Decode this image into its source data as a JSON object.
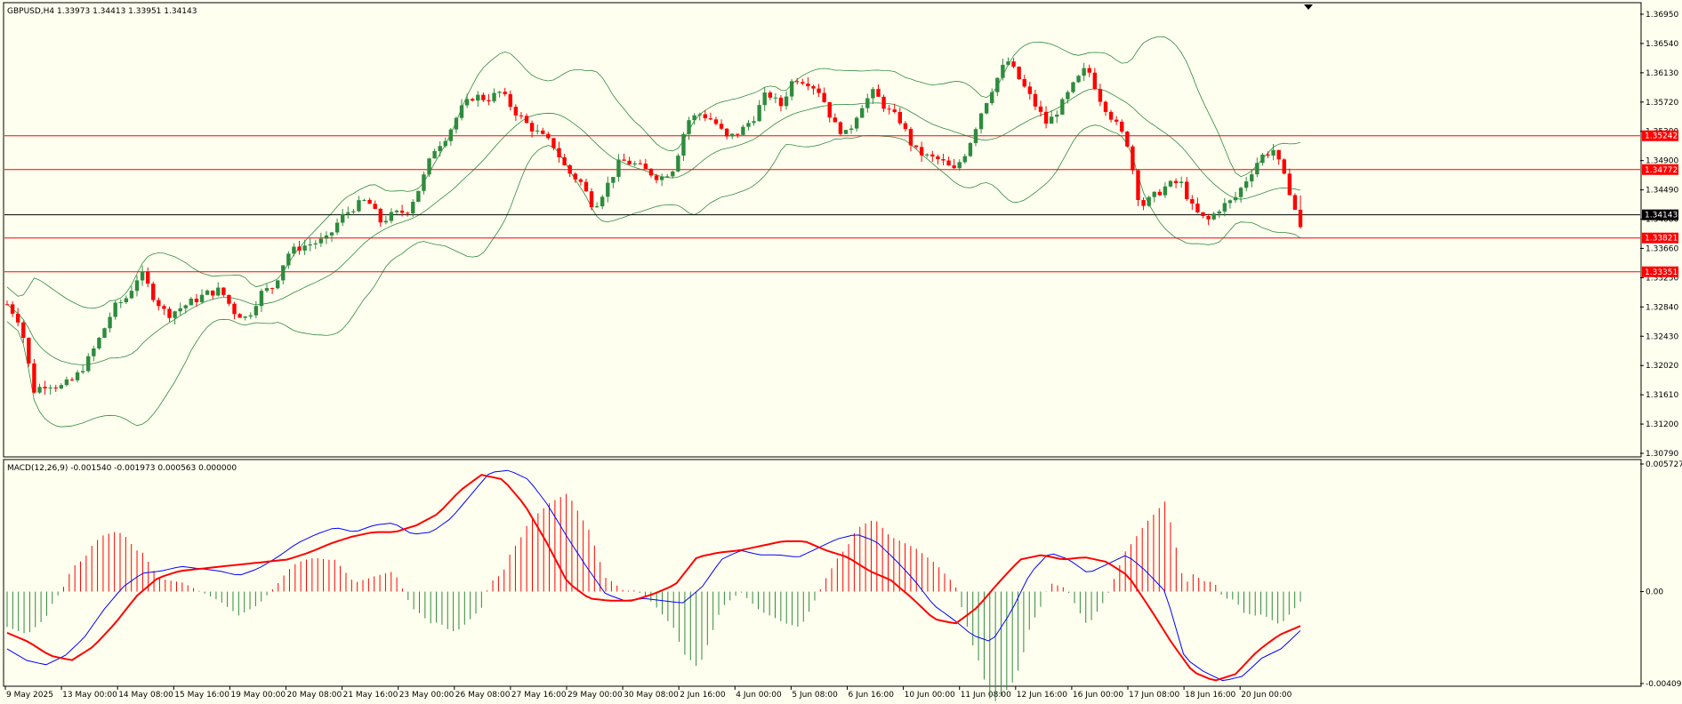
{
  "symbol_header": {
    "text": "GBPUSD,H4  1.33973 1.34413 1.33951 1.34143"
  },
  "indicator_header": {
    "text": "MACD(12,26,9) -0.001540 -0.001973 0.000563 0.000000"
  },
  "colors": {
    "background": "#fffff0",
    "bull_candle": "#2e8b3e",
    "bear_candle": "#ff0000",
    "bollinger": "#2e8b3e",
    "hline": "#ff0000",
    "price_line": "#000000",
    "macd_main": "#0000ff",
    "macd_signal": "#ff0000",
    "hist_positive": "#ff0000",
    "hist_negative": "#2e8b3e"
  },
  "price_axis": {
    "labels": [
      "1.36950",
      "1.36540",
      "1.36130",
      "1.35720",
      "1.35300",
      "1.34900",
      "1.34490",
      "1.34080",
      "1.33660",
      "1.33250",
      "1.32840",
      "1.32430",
      "1.32020",
      "1.31610",
      "1.31200",
      "1.30790"
    ]
  },
  "price_tags": [
    {
      "label": "1.35242",
      "price": 1.35242,
      "color": "#ff0000",
      "line_color": "#ff0000"
    },
    {
      "label": "1.34772",
      "price": 1.34772,
      "color": "#ff0000",
      "line_color": "#ff0000"
    },
    {
      "label": "1.34143",
      "price": 1.34143,
      "color": "#000000",
      "line_color": "#000000"
    },
    {
      "label": "1.33821",
      "price": 1.33821,
      "color": "#ff0000",
      "line_color": "#ff0000"
    },
    {
      "label": "1.33351",
      "price": 1.33351,
      "color": "#ff0000",
      "line_color": "#ff0000"
    }
  ],
  "macd_axis": {
    "labels": [
      "0.005727",
      "0.00",
      "-0.004094"
    ]
  },
  "time_axis": {
    "labels": [
      "9 May 2025",
      "13 May 00:00",
      "14 May 08:00",
      "15 May 16:00",
      "19 May 00:00",
      "20 May 08:00",
      "21 May 16:00",
      "23 May 00:00",
      "26 May 08:00",
      "27 May 16:00",
      "29 May 00:00",
      "30 May 08:00",
      "2 Jun 16:00",
      "4 Jun 00:00",
      "5 Jun 08:00",
      "6 Jun 16:00",
      "10 Jun 00:00",
      "11 Jun 08:00",
      "12 Jun 16:00",
      "16 Jun 00:00",
      "17 Jun 08:00",
      "18 Jun 16:00",
      "20 Jun 00:00"
    ]
  },
  "chart_data": {
    "type": "candlestick",
    "symbol": "GBPUSD",
    "timeframe": "H4",
    "ylim": [
      1.3079,
      1.3708
    ],
    "macd_ylim": [
      -0.004094,
      0.005727
    ],
    "close_path": [
      1.329,
      1.3265,
      1.317,
      1.318,
      1.3175,
      1.3185,
      1.321,
      1.3245,
      1.3285,
      1.33,
      1.3335,
      1.33,
      1.3275,
      1.3285,
      1.3295,
      1.3305,
      1.331,
      1.328,
      1.327,
      1.3305,
      1.3315,
      1.336,
      1.337,
      1.3375,
      1.338,
      1.341,
      1.3425,
      1.3435,
      1.3405,
      1.3415,
      1.342,
      1.3455,
      1.3505,
      1.3525,
      1.356,
      1.358,
      1.3575,
      1.3585,
      1.356,
      1.354,
      1.3525,
      1.351,
      1.3475,
      1.346,
      1.3425,
      1.3455,
      1.349,
      1.3485,
      1.3475,
      1.3465,
      1.348,
      1.3545,
      1.3555,
      1.3545,
      1.352,
      1.353,
      1.355,
      1.3585,
      1.3565,
      1.3605,
      1.36,
      1.3585,
      1.354,
      1.3525,
      1.3565,
      1.3585,
      1.356,
      1.3545,
      1.3505,
      1.3495,
      1.349,
      1.3475,
      1.3505,
      1.3555,
      1.3595,
      1.363,
      1.36,
      1.357,
      1.354,
      1.3565,
      1.3595,
      1.362,
      1.3575,
      1.3545,
      1.3515,
      1.3425,
      1.344,
      1.3455,
      1.346,
      1.342,
      1.3405,
      1.3425,
      1.3435,
      1.3465,
      1.3495,
      1.3505,
      1.3455,
      1.3415
    ],
    "macd_main": [
      -0.0025,
      -0.003,
      -0.0032,
      -0.0028,
      -0.002,
      -0.0008,
      0.0002,
      0.0008,
      0.0009,
      0.0011,
      0.001,
      0.0009,
      0.0007,
      0.001,
      0.0015,
      0.0021,
      0.0025,
      0.0028,
      0.0026,
      0.0029,
      0.003,
      0.0025,
      0.0026,
      0.0032,
      0.0042,
      0.0052,
      0.0053,
      0.0049,
      0.0038,
      0.0024,
      0.0011,
      -0.0001,
      -0.0004,
      -0.0003,
      -0.0004,
      -0.0005,
      0.0002,
      0.0014,
      0.0018,
      0.0016,
      0.0016,
      0.0015,
      0.0019,
      0.0023,
      0.0025,
      0.0022,
      0.0014,
      0.0005,
      -0.0006,
      -0.0012,
      -0.0019,
      -0.0022,
      -0.0009,
      0.0008,
      0.0017,
      0.0014,
      0.0008,
      0.0012,
      0.0016,
      0.0009,
      0.0,
      -0.0029,
      -0.0035,
      -0.0039,
      -0.0037,
      -0.0029,
      -0.0025,
      -0.0017
    ],
    "macd_signal": [
      -0.0018,
      -0.0022,
      -0.0028,
      -0.003,
      -0.0024,
      -0.0014,
      -0.0002,
      0.0006,
      0.0009,
      0.001,
      0.0011,
      0.0012,
      0.0013,
      0.0014,
      0.0017,
      0.0021,
      0.0024,
      0.0026,
      0.0026,
      0.0029,
      0.0034,
      0.0044,
      0.0051,
      0.0049,
      0.0038,
      0.0022,
      0.0004,
      -0.0003,
      -0.0004,
      -0.0004,
      -0.0001,
      0.0003,
      0.0015,
      0.0017,
      0.0018,
      0.002,
      0.0022,
      0.0022,
      0.0018,
      0.0015,
      0.0009,
      0.0005,
      -0.0003,
      -0.0012,
      -0.0014,
      -0.0007,
      0.0004,
      0.0014,
      0.0016,
      0.0014,
      0.0015,
      0.0013,
      0.0007,
      -0.0007,
      -0.0022,
      -0.0035,
      -0.0039,
      -0.0036,
      -0.0026,
      -0.0019,
      -0.0015
    ]
  }
}
